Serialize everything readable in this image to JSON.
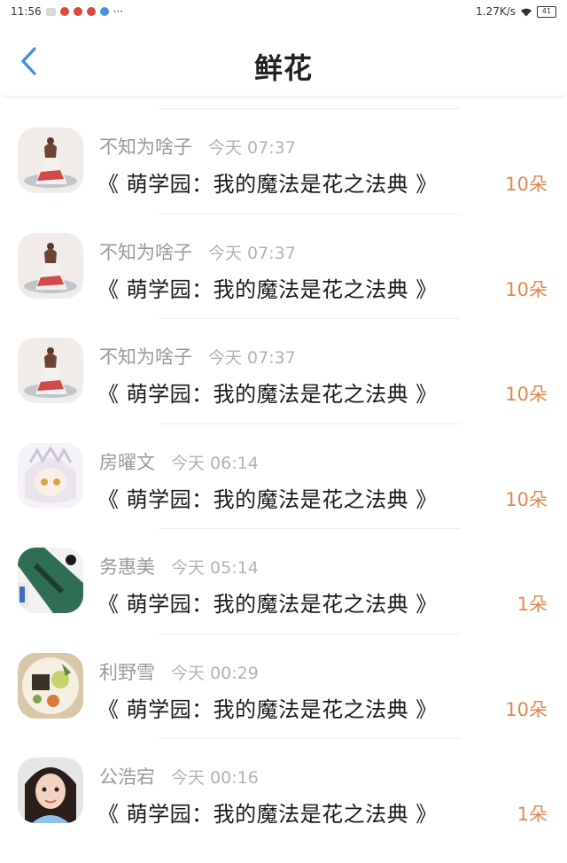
{
  "status_bar": {
    "time": "11:56",
    "network_speed": "1.27K/s",
    "battery": "41",
    "notification_icons": [
      "message-icon",
      "weibo-icon",
      "weibo-icon",
      "weibo-icon",
      "browser-icon"
    ],
    "more": "···"
  },
  "header": {
    "title": "鲜花",
    "back_icon": "chevron-left-icon"
  },
  "list": {
    "items": [
      {
        "user": "不知为啥子",
        "time": "今天 07:37",
        "book": "《 萌学园：我的魔法是花之法典 》",
        "count": "10朵"
      },
      {
        "user": "不知为啥子",
        "time": "今天 07:37",
        "book": "《 萌学园：我的魔法是花之法典 》",
        "count": "10朵"
      },
      {
        "user": "不知为啥子",
        "time": "今天 07:37",
        "book": "《 萌学园：我的魔法是花之法典 》",
        "count": "10朵"
      },
      {
        "user": "房曜文",
        "time": "今天 06:14",
        "book": "《 萌学园：我的魔法是花之法典 》",
        "count": "10朵"
      },
      {
        "user": "务惠美",
        "time": "今天 05:14",
        "book": "《 萌学园：我的魔法是花之法典 》",
        "count": "1朵"
      },
      {
        "user": "利野雪",
        "time": "今天 00:29",
        "book": "《 萌学园：我的魔法是花之法典 》",
        "count": "10朵"
      },
      {
        "user": "公浩宕",
        "time": "今天 00:16",
        "book": "《 萌学园：我的魔法是花之法典 》",
        "count": "1朵"
      }
    ]
  },
  "colors": {
    "accent": "#3b8fe0",
    "count": "#e08a4f",
    "name": "#9a9a9a",
    "time": "#b3b3b3"
  }
}
